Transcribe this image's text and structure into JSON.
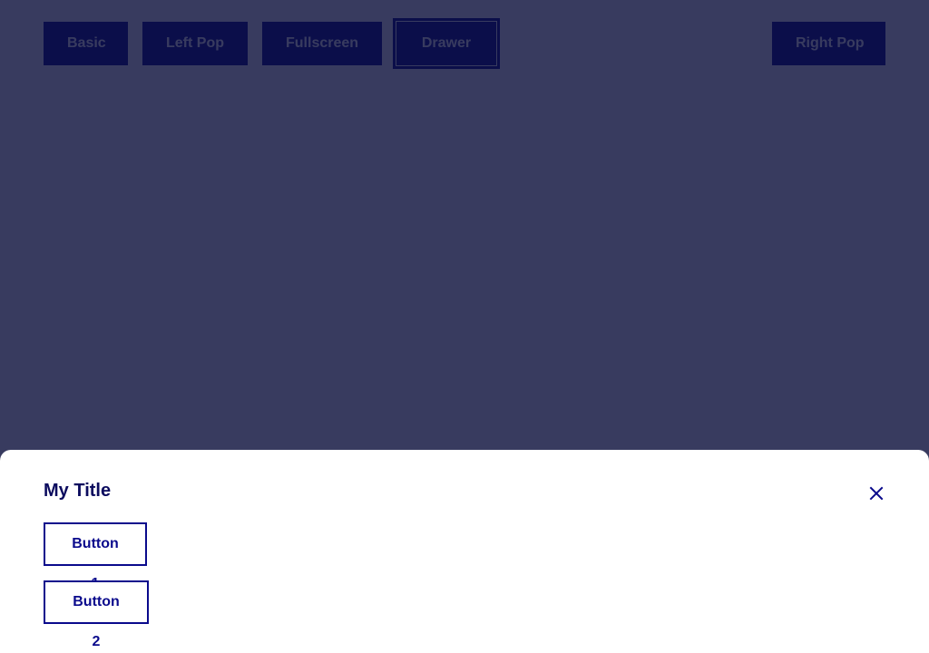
{
  "colors": {
    "primary": "#0a0a8c",
    "title": "#0b0b5e",
    "scrim": "#343860",
    "surface": "#ffffff"
  },
  "toolbar": {
    "basic_label": "Basic",
    "left_pop_label": "Left Pop",
    "fullscreen_label": "Fullscreen",
    "drawer_label": "Drawer",
    "right_pop_label": "Right Pop"
  },
  "drawer": {
    "title": "My Title",
    "close_icon": "close-icon",
    "buttons": [
      {
        "label": "Button 1"
      },
      {
        "label": "Button 2"
      }
    ]
  }
}
